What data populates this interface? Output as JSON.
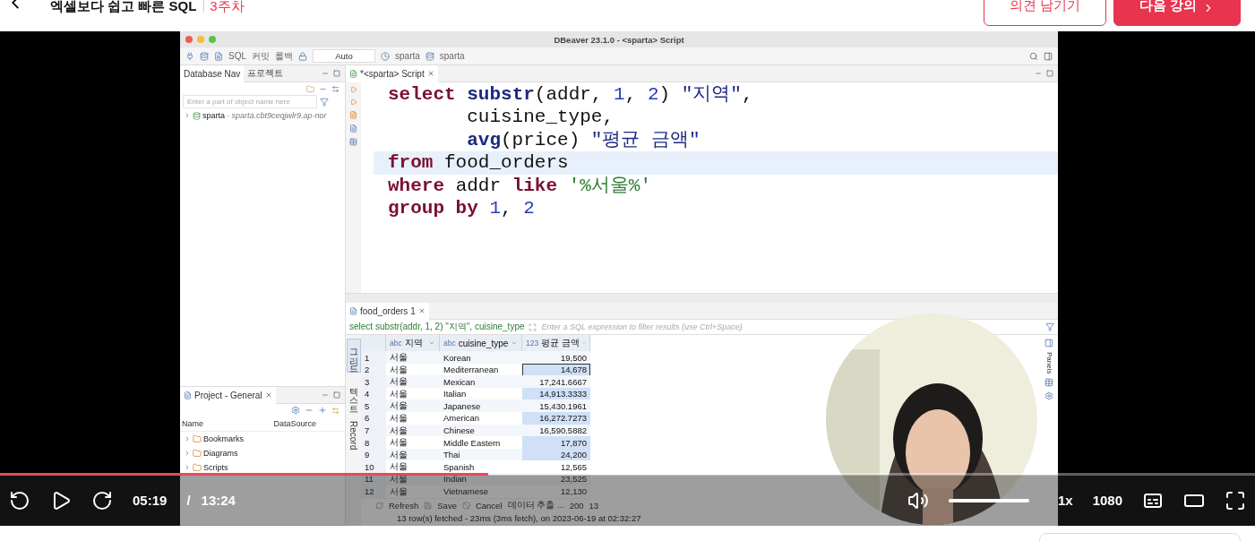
{
  "header": {
    "title": "엑셀보다 쉽고 빠른 SQL",
    "chapter": "3주차",
    "buttons": [
      {
        "label": "의견 남기기",
        "kind": "outline"
      },
      {
        "label": "다음 강의",
        "kind": "primary"
      }
    ]
  },
  "app": {
    "window_title": "DBeaver 23.1.0 - <sparta> Script",
    "toolbar": {
      "sql": "SQL",
      "commit": "커밋",
      "rollback": "롤백",
      "mode": "Auto",
      "datasource": "sparta",
      "schema": "sparta"
    },
    "navigator": {
      "tabs": [
        {
          "label": "Database Nav",
          "selected": true
        },
        {
          "label": "프로젝트",
          "selected": false
        }
      ],
      "filter_placeholder": "Enter a part of object name here",
      "tree": [
        {
          "label": "sparta",
          "detail": " - sparta.cbt9ceqjwlr9.ap-nor",
          "expanded": false
        }
      ]
    },
    "project": {
      "title": "Project - General",
      "columns": [
        "Name",
        "DataSource"
      ],
      "items": [
        {
          "label": "Bookmarks",
          "expanded": false
        },
        {
          "label": "Diagrams",
          "expanded": false
        },
        {
          "label": "Scripts",
          "expanded": false
        }
      ]
    },
    "editor": {
      "tab": "*<sparta> Script",
      "lines": [
        {
          "indent": false,
          "current": false,
          "tokens": [
            {
              "kind": "kw",
              "t": "select "
            },
            {
              "kind": "fn",
              "t": "substr"
            },
            {
              "kind": "plain",
              "t": "(addr, "
            },
            {
              "kind": "num",
              "t": "1"
            },
            {
              "kind": "plain",
              "t": ", "
            },
            {
              "kind": "num",
              "t": "2"
            },
            {
              "kind": "plain",
              "t": ") "
            },
            {
              "kind": "ident",
              "t": "\"지역\""
            },
            {
              "kind": "plain",
              "t": ","
            }
          ]
        },
        {
          "indent": true,
          "current": false,
          "tokens": [
            {
              "kind": "plain",
              "t": "cuisine_type,"
            }
          ]
        },
        {
          "indent": true,
          "current": false,
          "tokens": [
            {
              "kind": "fn",
              "t": "avg"
            },
            {
              "kind": "plain",
              "t": "(price) "
            },
            {
              "kind": "ident",
              "t": "\"평균 금액\""
            }
          ]
        },
        {
          "indent": false,
          "current": true,
          "tokens": [
            {
              "kind": "kw",
              "t": "from "
            },
            {
              "kind": "plain",
              "t": "food_orders"
            }
          ]
        },
        {
          "indent": false,
          "current": false,
          "tokens": [
            {
              "kind": "kw",
              "t": "where "
            },
            {
              "kind": "plain",
              "t": "addr "
            },
            {
              "kind": "kw",
              "t": "like "
            },
            {
              "kind": "str",
              "t": "'%서울%'"
            }
          ]
        },
        {
          "indent": false,
          "current": false,
          "tokens": [
            {
              "kind": "kw",
              "t": "group by "
            },
            {
              "kind": "num",
              "t": "1"
            },
            {
              "kind": "plain",
              "t": ", "
            },
            {
              "kind": "num",
              "t": "2"
            }
          ]
        }
      ]
    },
    "results": {
      "tab": "food_orders 1",
      "query": "select substr(addr, 1, 2) \"지역\", cuisine_type",
      "filter_placeholder": "Enter a SQL expression to filter results (use Ctrl+Space)",
      "side_tabs": [
        {
          "label": "그리드",
          "selected": true
        },
        {
          "label": "텍스트",
          "selected": false
        },
        {
          "label": "Record",
          "selected": false
        }
      ],
      "columns": [
        {
          "type": "abc",
          "label": "지역"
        },
        {
          "type": "abc",
          "label": "cuisine_type"
        },
        {
          "type": "123",
          "label": "평균 금액"
        }
      ],
      "rows": [
        {
          "n": "1",
          "region": "서울",
          "cuisine": "Korean",
          "avg": "19,500",
          "selected": false,
          "focused": false
        },
        {
          "n": "2",
          "region": "서울",
          "cuisine": "Mediterranean",
          "avg": "14,678",
          "selected": true,
          "focused": true
        },
        {
          "n": "3",
          "region": "서울",
          "cuisine": "Mexican",
          "avg": "17,241.6667",
          "selected": false,
          "focused": false
        },
        {
          "n": "4",
          "region": "서울",
          "cuisine": "Italian",
          "avg": "14,913.3333",
          "selected": true,
          "focused": false
        },
        {
          "n": "5",
          "region": "서울",
          "cuisine": "Japanese",
          "avg": "15,430.1961",
          "selected": false,
          "focused": false
        },
        {
          "n": "6",
          "region": "서울",
          "cuisine": "American",
          "avg": "16,272.7273",
          "selected": true,
          "focused": false
        },
        {
          "n": "7",
          "region": "서울",
          "cuisine": "Chinese",
          "avg": "16,590.5882",
          "selected": false,
          "focused": false
        },
        {
          "n": "8",
          "region": "서울",
          "cuisine": "Middle Eastern",
          "avg": "17,870",
          "selected": true,
          "focused": false
        },
        {
          "n": "9",
          "region": "서울",
          "cuisine": "Thai",
          "avg": "24,200",
          "selected": true,
          "focused": false
        },
        {
          "n": "10",
          "region": "서울",
          "cuisine": "Spanish",
          "avg": "12,565",
          "selected": false,
          "focused": false
        },
        {
          "n": "11",
          "region": "서울",
          "cuisine": "Indian",
          "avg": "23,525",
          "selected": false,
          "focused": false
        },
        {
          "n": "12",
          "region": "서울",
          "cuisine": "Vietnamese",
          "avg": "12,130",
          "selected": false,
          "focused": false
        }
      ],
      "toolbar": {
        "refresh": "Refresh",
        "save": "Save",
        "cancel": "Cancel",
        "export": "데이터 추출 ...",
        "fetch_size": "200",
        "row_count": "13"
      },
      "status": "13 row(s) fetched - 23ms (3ms fetch), on 2023-06-19 at 02:32:27",
      "panels_label": "Panels"
    }
  },
  "controls": {
    "progress": {
      "level": 0.389
    },
    "elapsed": "05:19",
    "separator": "/",
    "duration": "13:24",
    "volume": {
      "level": 1
    },
    "speed": "1x",
    "quality": "1080"
  }
}
